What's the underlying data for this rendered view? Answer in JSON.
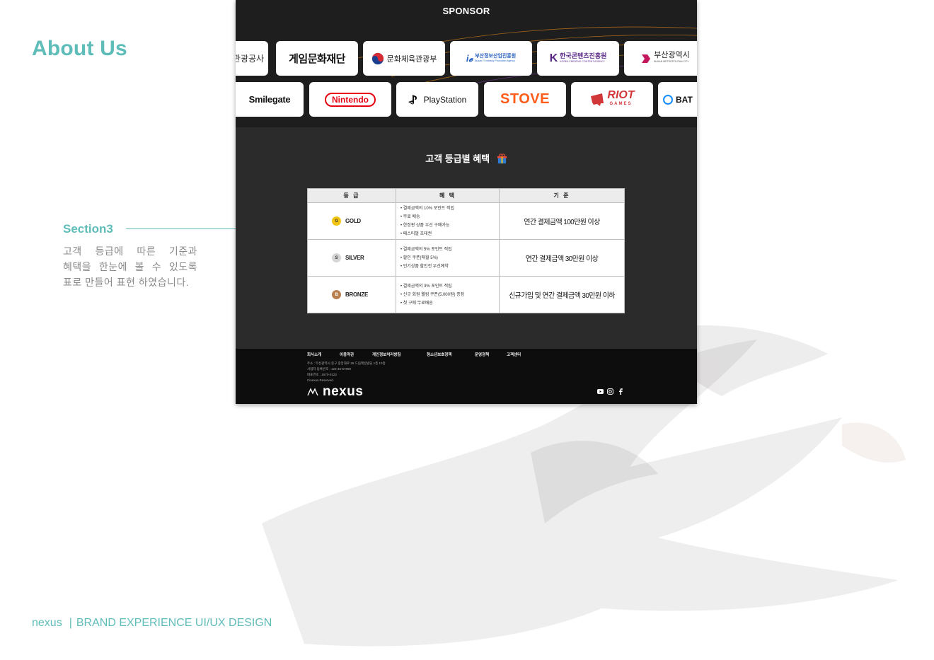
{
  "page": {
    "heading": "About Us",
    "section_title": "Section3",
    "section_description": "고객 등급에 따른 기준과 혜택을 한눈에 볼 수 있도록 표로 만들어 표현 하였습니다.",
    "footer_brand": "nexus",
    "footer_separator": "|",
    "footer_tagline": "BRAND EXPERIENCE UI/UX DESIGN",
    "accent_color": "#5fbdb9"
  },
  "site": {
    "sponsor_title": "SPONSOR",
    "sponsor_row1": [
      {
        "label": "관광공사",
        "icon": "tourism-logo"
      },
      {
        "label": "게임문화재단",
        "icon": "game-culture-foundation-logo"
      },
      {
        "label": "문화체육관광부",
        "icon": "korea-taegeuk-icon"
      },
      {
        "label": "부산정보산업진흥원",
        "sub": "Busan IT Industry Promotion Agency",
        "icon": "bipa-logo"
      },
      {
        "label": "한국콘텐츠진흥원",
        "sub": "KOREA CREATIVE CONTENT AGENCY",
        "icon": "kocca-logo"
      },
      {
        "label": "부산광역시",
        "sub": "BUSAN METROPOLITAN CITY",
        "icon": "busan-logo"
      }
    ],
    "sponsor_row2": [
      {
        "label": "Smilegate",
        "icon": "smilegate-logo"
      },
      {
        "label": "Nintendo",
        "icon": "nintendo-logo"
      },
      {
        "label": "PlayStation",
        "icon": "playstation-logo"
      },
      {
        "label": "STOVE",
        "icon": "stove-logo"
      },
      {
        "label": "RIOT",
        "sub": "GAMES",
        "icon": "riot-games-logo"
      },
      {
        "label": "BAT",
        "icon": "battlenet-logo"
      }
    ],
    "benefit_title": "고객 등급별 혜택",
    "table": {
      "headers": [
        "등 급",
        "혜 택",
        "기 준"
      ],
      "rows": [
        {
          "badge": "G",
          "grade": "GOLD",
          "badge_color": "#f1c40f",
          "benefits": [
            "결제금액의 10% 포인트 적립",
            "무료 배송",
            "한정판 상품 우선 구매가능",
            "페스티벌 초대권"
          ],
          "criteria": "연간 결제금액 100만원 이상"
        },
        {
          "badge": "S",
          "grade": "SILVER",
          "badge_color": "#c9c9c9",
          "benefits": [
            "결제금액의 5% 포인트 적립",
            "할인 쿠폰(매월 5%)",
            "인기상품 할인전 우선예약"
          ],
          "criteria": "연간 결제금액 30만원 이상"
        },
        {
          "badge": "B",
          "grade": "BRONZE",
          "badge_color": "#b8804f",
          "benefits": [
            "결제금액의 3% 포인트 적립",
            "신규 회원 웰컴 쿠폰(5,000원) 증정",
            "첫 구매 무료배송"
          ],
          "criteria": "신규가입 및 연간 결제금액 30만원 이하"
        }
      ]
    },
    "footer_menu": [
      "회사소개",
      "이용약관",
      "개인정보처리방침",
      "청소년보호정책",
      "운영정책",
      "고객센터"
    ],
    "footer_info": [
      "주소 : 부산광역시 중구 중앙대로 26 드림레일빌딩 1층 10층",
      "사업자 등록번호 : 123-45-67890",
      "대표번호 : 1670-0123",
      "Cinexus.Reserved."
    ],
    "footer_logo": "nexus"
  }
}
